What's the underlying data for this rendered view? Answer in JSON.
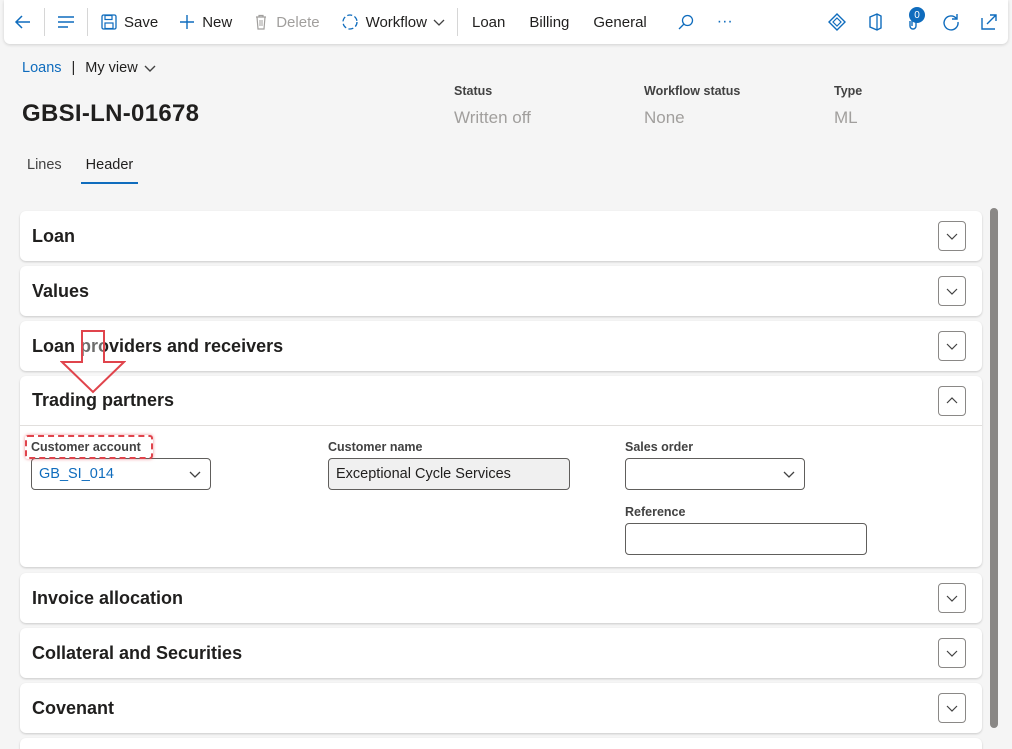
{
  "toolbar": {
    "save_label": "Save",
    "new_label": "New",
    "delete_label": "Delete",
    "workflow_label": "Workflow",
    "tab_loan": "Loan",
    "tab_billing": "Billing",
    "tab_general": "General",
    "more_label": "···",
    "attachments_count": "0"
  },
  "breadcrumb": {
    "root": "Loans",
    "separator": "|",
    "view": "My view"
  },
  "record": {
    "title": "GBSI-LN-01678",
    "status_label": "Status",
    "status_value": "Written off",
    "workflow_status_label": "Workflow status",
    "workflow_status_value": "None",
    "type_label": "Type",
    "type_value": "ML"
  },
  "tabs": [
    {
      "label": "Lines"
    },
    {
      "label": "Header"
    }
  ],
  "sections": [
    {
      "title": "Loan"
    },
    {
      "title": "Values"
    },
    {
      "title": "Loan providers and receivers"
    },
    {
      "title": "Trading partners"
    },
    {
      "title": "Invoice allocation"
    },
    {
      "title": "Collateral and Securities"
    },
    {
      "title": "Covenant"
    }
  ],
  "trading_partners": {
    "customer_account_label": "Customer account",
    "customer_account_value": "GB_SI_014",
    "customer_name_label": "Customer name",
    "customer_name_value": "Exceptional Cycle Services",
    "sales_order_label": "Sales order",
    "sales_order_value": "",
    "reference_label": "Reference",
    "reference_value": ""
  },
  "colors": {
    "accent": "#0f6cbd",
    "annotation": "#e0444c"
  }
}
